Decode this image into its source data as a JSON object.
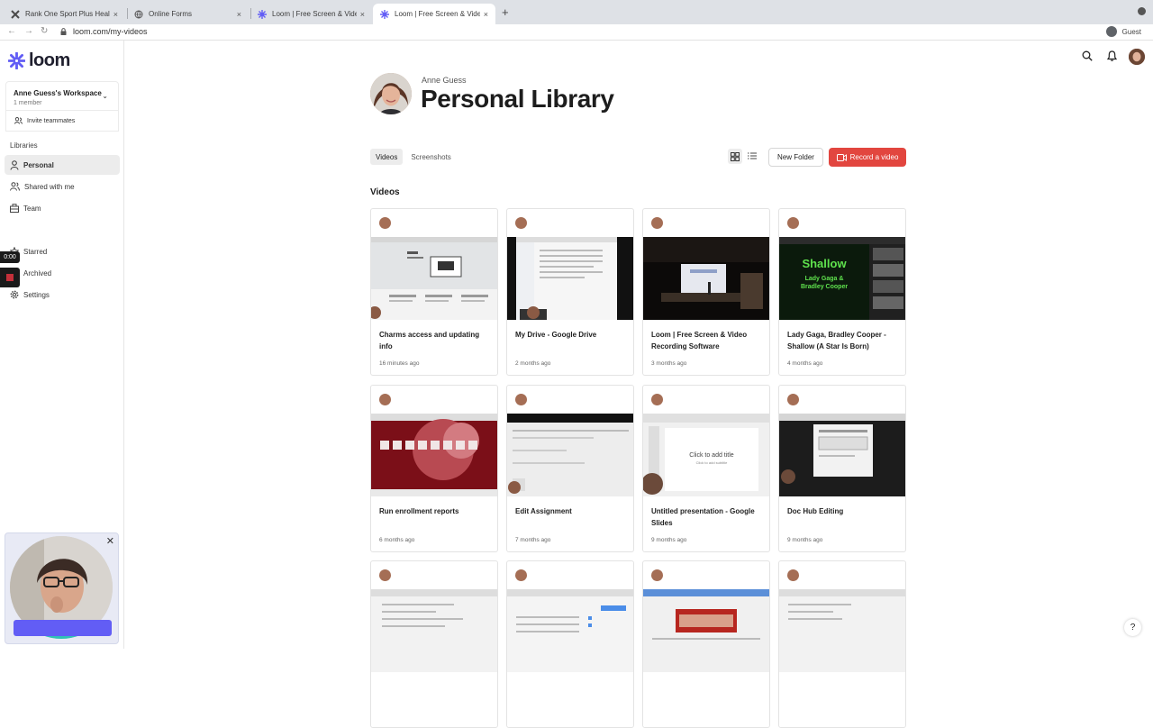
{
  "browser": {
    "tabs": [
      {
        "title": "Rank One Sport Plus Health",
        "close": "×"
      },
      {
        "title": "Online Forms",
        "close": "×"
      },
      {
        "title": "Loom | Free Screen & Video Re",
        "close": "×"
      },
      {
        "title": "Loom | Free Screen & Video Re",
        "close": "×"
      }
    ],
    "new_tab": "+",
    "url": "loom.com/my-videos",
    "profile_label": "Guest"
  },
  "sidebar": {
    "logo": "loom",
    "workspace_name": "Anne Guess's Workspace",
    "workspace_members": "1 member",
    "invite": "Invite teammates",
    "libraries_label": "Libraries",
    "items": [
      {
        "label": "Personal",
        "icon": "person-icon"
      },
      {
        "label": "Shared with me",
        "icon": "people-icon"
      },
      {
        "label": "Team",
        "icon": "building-icon"
      },
      {
        "label": "Starred",
        "icon": "star-icon"
      },
      {
        "label": "Archived",
        "icon": "archive-icon"
      },
      {
        "label": "Settings",
        "icon": "gear-icon"
      }
    ]
  },
  "recorder": {
    "elapsed": "0:00"
  },
  "main": {
    "owner": "Anne Guess",
    "title": "Personal Library",
    "tabs": [
      "Videos",
      "Screenshots"
    ],
    "new_folder": "New Folder",
    "record": "Record a video",
    "section": "Videos",
    "videos": [
      {
        "title": "Charms access and updating info",
        "date": "16 minutes ago"
      },
      {
        "title": "My Drive - Google Drive",
        "date": "2 months ago"
      },
      {
        "title": "Loom | Free Screen & Video Recording Software",
        "date": "3 months ago"
      },
      {
        "title": "Lady Gaga, Bradley Cooper - Shallow (A Star Is Born) (Karaok…",
        "date": "4 months ago"
      },
      {
        "title": "Run enrollment reports",
        "date": "6 months ago"
      },
      {
        "title": "Edit Assignment",
        "date": "7 months ago"
      },
      {
        "title": "Untitled presentation - Google Slides",
        "date": "9 months ago"
      },
      {
        "title": "Doc Hub Editing",
        "date": "9 months ago"
      },
      {
        "title": "",
        "date": ""
      },
      {
        "title": "",
        "date": ""
      },
      {
        "title": "",
        "date": ""
      },
      {
        "title": "",
        "date": ""
      }
    ],
    "thumb_text": {
      "shallow_title": "Shallow",
      "shallow_sub": "Lady Gaga &\nBradley Cooper",
      "slides_title": "Click to add title",
      "slides_sub": "Click to add subtitle"
    }
  },
  "help": "?",
  "colors": {
    "brand": "#625df5",
    "record": "#e2463f"
  }
}
